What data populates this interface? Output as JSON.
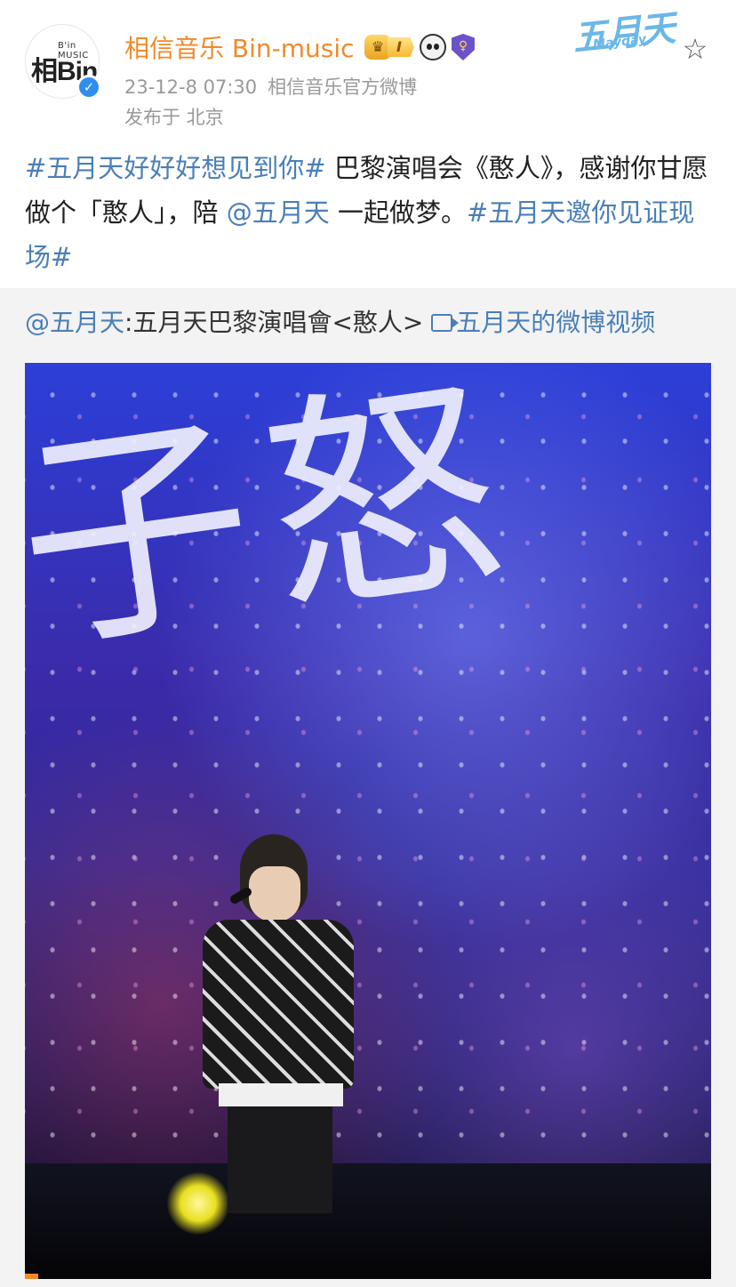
{
  "user": {
    "avatar_label_small": "B'in MUSIC",
    "avatar_label_main": "相Bin",
    "name": "相信音乐 Bin-music",
    "level_badge": "I",
    "verified_mark": "✓",
    "timestamp": "23-12-8 07:30",
    "source": "相信音乐官方微博",
    "location": "发布于 北京"
  },
  "header_logo": {
    "main": "五月天",
    "sub": "Mayday"
  },
  "post": {
    "hashtag1": "#五月天好好好想见到你#",
    "text1": " 巴黎演唱会《憨人》，感谢你甘愿做个「憨人」，陪 ",
    "mention": "@五月天",
    "text2": " 一起做梦。",
    "hashtag2": "#五月天邀你见证现场#"
  },
  "repost": {
    "mention": "@五月天",
    "title": ":五月天巴黎演唱會<憨人> ",
    "video_link": "五月天的微博视频"
  },
  "video": {
    "screen_text": "子怒",
    "progress": 0.02
  },
  "colors": {
    "username": "#f08a2c",
    "link": "#4a7fb8",
    "meta": "#999999",
    "repost_bg": "#f3f3f3"
  }
}
